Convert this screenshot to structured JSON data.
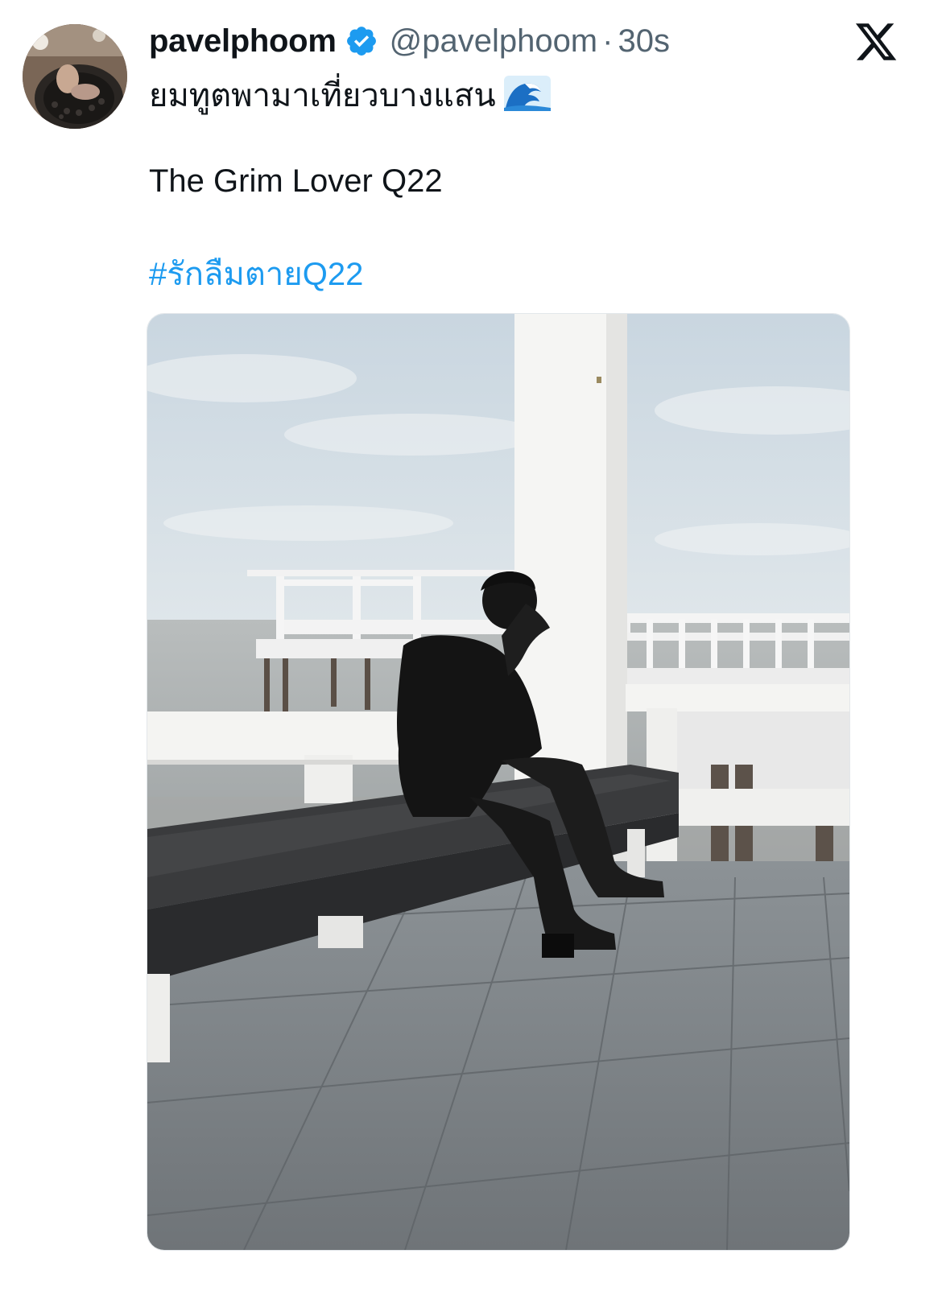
{
  "tweet": {
    "display_name": "pavelphoom",
    "handle": "@pavelphoom",
    "separator": "·",
    "time": "30s",
    "line1": "ยมทูตพามาเที่ยวบางแสน",
    "line2": "The Grim Lover Q22",
    "hashtag": "#รักลืมตายQ22"
  },
  "icons": {
    "verified": "verified-badge-icon",
    "close": "x-logo-icon",
    "wave": "water-wave-emoji-icon"
  },
  "colors": {
    "accent": "#1d9bf0",
    "text": "#0f1419",
    "secondary": "#536471"
  }
}
